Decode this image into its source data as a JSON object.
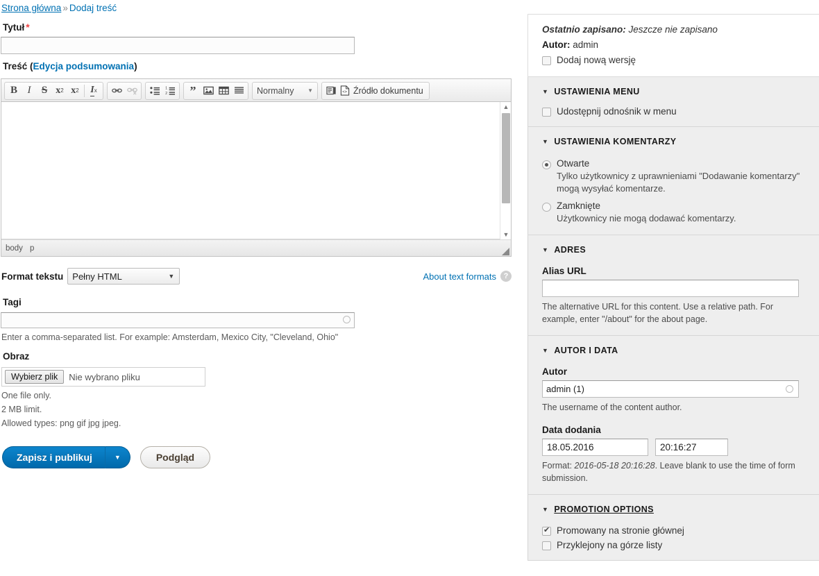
{
  "breadcrumb": {
    "home": "Strona główna",
    "separator": "»",
    "current": "Dodaj treść"
  },
  "form": {
    "title_label": "Tytuł",
    "title_required_mark": "*",
    "title_value": "",
    "body_label": "Treść (",
    "body_label_link": "Edycja podsumowania",
    "body_label_suffix": ")",
    "editor": {
      "buttons": {
        "bold": "B",
        "italic": "I",
        "strikethrough": "S",
        "superscript": "x",
        "superscript_sup": "2",
        "subscript": "x",
        "subscript_sub": "2",
        "remove_format": "I",
        "remove_format_sub": "x",
        "link": "🔗",
        "unlink": "🔗",
        "bulleted_list": "•",
        "numbered_list": "1",
        "blockquote": "”",
        "image": "🖼",
        "table": "▦",
        "horizontal_rule": "▤",
        "templates": "▤",
        "source_label": "Źródło dokumentu"
      },
      "paragraph_format": "Normalny",
      "path": [
        "body",
        "p"
      ],
      "content": ""
    },
    "text_format_label": "Format tekstu",
    "text_format_value": "Pełny HTML",
    "about_text_formats": "About text formats",
    "help_icon_glyph": "?",
    "tags_label": "Tagi",
    "tags_value": "",
    "tags_description": "Enter a comma-separated list. For example: Amsterdam, Mexico City, \"Cleveland, Ohio\"",
    "image_label": "Obraz",
    "file_button": "Wybierz plik",
    "file_status": "Nie wybrano pliku",
    "image_desc_1": "One file only.",
    "image_desc_2": "2 MB limit.",
    "image_desc_3": "Allowed types: png gif jpg jpeg.",
    "save_button": "Zapisz i publikuj",
    "save_button_caret": "▼",
    "preview_button": "Podgląd"
  },
  "sidebar": {
    "meta": {
      "last_saved_label": "Ostatnio zapisano:",
      "last_saved_value": "Jeszcze nie zapisano",
      "author_label": "Autor:",
      "author_value": "admin",
      "new_revision_label": "Dodaj nową wersję",
      "new_revision_checked": false
    },
    "menu_settings": {
      "title": "USTAWIENIA MENU",
      "toggle_glyph": "▼",
      "provide_menu_link_label": "Udostępnij odnośnik w menu",
      "provide_menu_link_checked": false
    },
    "comment_settings": {
      "title": "USTAWIENIA KOMENTARZY",
      "toggle_glyph": "▼",
      "open_label": "Otwarte",
      "open_selected": true,
      "open_description": "Tylko użytkownicy z uprawnieniami \"Dodawanie komentarzy\" mogą wysyłać komentarze.",
      "closed_label": "Zamknięte",
      "closed_selected": false,
      "closed_description": "Użytkownicy nie mogą dodawać komentarzy."
    },
    "address": {
      "title": "ADRES",
      "toggle_glyph": "▼",
      "url_alias_label": "Alias URL",
      "url_alias_value": "",
      "description": "The alternative URL for this content. Use a relative path. For example, enter \"/about\" for the about page."
    },
    "author_date": {
      "title": "AUTOR I DATA",
      "toggle_glyph": "▼",
      "author_label": "Autor",
      "author_value": "admin (1)",
      "author_description": "The username of the content author.",
      "date_label": "Data dodania",
      "date_value": "18.05.2016",
      "time_value": "20:16:27",
      "format_prefix": "Format: ",
      "format_example": "2016-05-18 20:16:28",
      "format_suffix": ". Leave blank to use the time of form submission."
    },
    "promotion": {
      "title": "PROMOTION OPTIONS",
      "toggle_glyph": "▼",
      "promoted_label": "Promowany na stronie głównej",
      "promoted_checked": true,
      "sticky_label": "Przyklejony na górze listy",
      "sticky_checked": false
    }
  },
  "colors": {
    "link": "#0071b3",
    "primary_button": "#0071b8",
    "required": "#e44444",
    "panel_bg": "#eeeeee"
  }
}
